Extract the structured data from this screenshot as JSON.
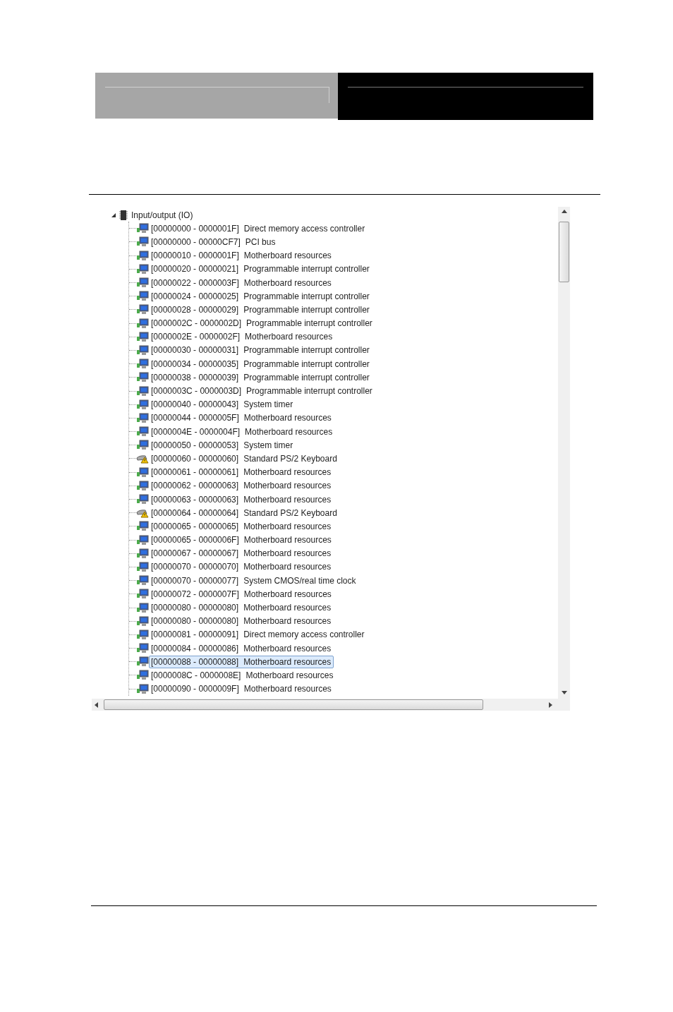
{
  "tree": {
    "root": {
      "label": "Input/output (IO)",
      "expanded": true,
      "children": [
        {
          "range": "[00000000 - 0000001F]",
          "name": "Direct memory access controller",
          "kind": "device",
          "selected": false
        },
        {
          "range": "[00000000 - 00000CF7]",
          "name": "PCI bus",
          "kind": "device",
          "selected": false
        },
        {
          "range": "[00000010 - 0000001F]",
          "name": "Motherboard resources",
          "kind": "device",
          "selected": false
        },
        {
          "range": "[00000020 - 00000021]",
          "name": "Programmable interrupt controller",
          "kind": "device",
          "selected": false
        },
        {
          "range": "[00000022 - 0000003F]",
          "name": "Motherboard resources",
          "kind": "device",
          "selected": false
        },
        {
          "range": "[00000024 - 00000025]",
          "name": "Programmable interrupt controller",
          "kind": "device",
          "selected": false
        },
        {
          "range": "[00000028 - 00000029]",
          "name": "Programmable interrupt controller",
          "kind": "device",
          "selected": false
        },
        {
          "range": "[0000002C - 0000002D]",
          "name": "Programmable interrupt controller",
          "kind": "device",
          "selected": false
        },
        {
          "range": "[0000002E - 0000002F]",
          "name": "Motherboard resources",
          "kind": "device",
          "selected": false
        },
        {
          "range": "[00000030 - 00000031]",
          "name": "Programmable interrupt controller",
          "kind": "device",
          "selected": false
        },
        {
          "range": "[00000034 - 00000035]",
          "name": "Programmable interrupt controller",
          "kind": "device",
          "selected": false
        },
        {
          "range": "[00000038 - 00000039]",
          "name": "Programmable interrupt controller",
          "kind": "device",
          "selected": false
        },
        {
          "range": "[0000003C - 0000003D]",
          "name": "Programmable interrupt controller",
          "kind": "device",
          "selected": false
        },
        {
          "range": "[00000040 - 00000043]",
          "name": "System timer",
          "kind": "device",
          "selected": false
        },
        {
          "range": "[00000044 - 0000005F]",
          "name": "Motherboard resources",
          "kind": "device",
          "selected": false
        },
        {
          "range": "[0000004E - 0000004F]",
          "name": "Motherboard resources",
          "kind": "device",
          "selected": false
        },
        {
          "range": "[00000050 - 00000053]",
          "name": "System timer",
          "kind": "device",
          "selected": false
        },
        {
          "range": "[00000060 - 00000060]",
          "name": "Standard PS/2 Keyboard",
          "kind": "warning",
          "selected": false
        },
        {
          "range": "[00000061 - 00000061]",
          "name": "Motherboard resources",
          "kind": "device",
          "selected": false
        },
        {
          "range": "[00000062 - 00000063]",
          "name": "Motherboard resources",
          "kind": "device",
          "selected": false
        },
        {
          "range": "[00000063 - 00000063]",
          "name": "Motherboard resources",
          "kind": "device",
          "selected": false
        },
        {
          "range": "[00000064 - 00000064]",
          "name": "Standard PS/2 Keyboard",
          "kind": "warning",
          "selected": false
        },
        {
          "range": "[00000065 - 00000065]",
          "name": "Motherboard resources",
          "kind": "device",
          "selected": false
        },
        {
          "range": "[00000065 - 0000006F]",
          "name": "Motherboard resources",
          "kind": "device",
          "selected": false
        },
        {
          "range": "[00000067 - 00000067]",
          "name": "Motherboard resources",
          "kind": "device",
          "selected": false
        },
        {
          "range": "[00000070 - 00000070]",
          "name": "Motherboard resources",
          "kind": "device",
          "selected": false
        },
        {
          "range": "[00000070 - 00000077]",
          "name": "System CMOS/real time clock",
          "kind": "device",
          "selected": false
        },
        {
          "range": "[00000072 - 0000007F]",
          "name": "Motherboard resources",
          "kind": "device",
          "selected": false
        },
        {
          "range": "[00000080 - 00000080]",
          "name": "Motherboard resources",
          "kind": "device",
          "selected": false
        },
        {
          "range": "[00000080 - 00000080]",
          "name": "Motherboard resources",
          "kind": "device",
          "selected": false
        },
        {
          "range": "[00000081 - 00000091]",
          "name": "Direct memory access controller",
          "kind": "device",
          "selected": false
        },
        {
          "range": "[00000084 - 00000086]",
          "name": "Motherboard resources",
          "kind": "device",
          "selected": false
        },
        {
          "range": "[00000088 - 00000088]",
          "name": "Motherboard resources",
          "kind": "device",
          "selected": true
        },
        {
          "range": "[0000008C - 0000008E]",
          "name": "Motherboard resources",
          "kind": "device",
          "selected": false
        },
        {
          "range": "[00000090 - 0000009F]",
          "name": "Motherboard resources",
          "kind": "device",
          "selected": false
        }
      ]
    }
  }
}
